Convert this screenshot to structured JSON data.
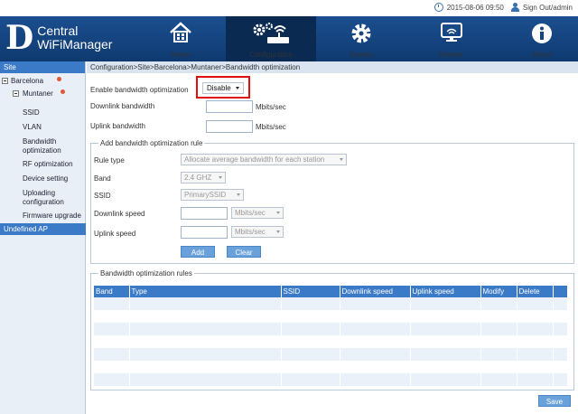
{
  "topbar": {
    "datetime": "2015-08-06 09:50",
    "signout": "Sign Out/admin"
  },
  "logo": {
    "letter": "D",
    "line1": "Central",
    "line2": "WiFiManager"
  },
  "nav": [
    {
      "label": "Home",
      "icon": "home-icon"
    },
    {
      "label": "Configuration",
      "icon": "configuration-icon",
      "active": true
    },
    {
      "label": "System",
      "icon": "gear-icon"
    },
    {
      "label": "Monitor",
      "icon": "monitor-icon"
    },
    {
      "label": "About",
      "icon": "info-icon"
    }
  ],
  "sidebar": {
    "header": "Site",
    "site": "Barcelona",
    "network": "Muntaner",
    "items": [
      "SSID",
      "VLAN",
      "Bandwidth optimization",
      "RF optimization",
      "Device setting",
      "Uploading configuration",
      "Firmware upgrade"
    ],
    "undefined_ap": "Undefined AP"
  },
  "breadcrumb": "Configuration>Site>Barcelona>Muntaner>Bandwidth optimization",
  "form": {
    "enable_label": "Enable bandwidth optimization",
    "enable_value": "Disable",
    "downlink_label": "Downlink bandwidth",
    "downlink_value": "",
    "uplink_label": "Uplink bandwidth",
    "uplink_value": "",
    "unit": "Mbits/sec"
  },
  "add_rule": {
    "legend": "Add bandwidth optimization rule",
    "rule_type_label": "Rule type",
    "rule_type_value": "Allocate average bandwidth for each station",
    "band_label": "Band",
    "band_value": "2.4 GHZ",
    "ssid_label": "SSID",
    "ssid_value": "PrimarySSID",
    "downlink_speed_label": "Downlink speed",
    "uplink_speed_label": "Uplink speed",
    "speed_unit": "Mbits/sec",
    "add_button": "Add",
    "clear_button": "Clear"
  },
  "rules": {
    "legend": "Bandwidth optimization rules",
    "columns": [
      "Band",
      "Type",
      "SSID",
      "Downlink speed",
      "Uplink speed",
      "Modify",
      "Delete"
    ]
  },
  "save_button": "Save"
}
